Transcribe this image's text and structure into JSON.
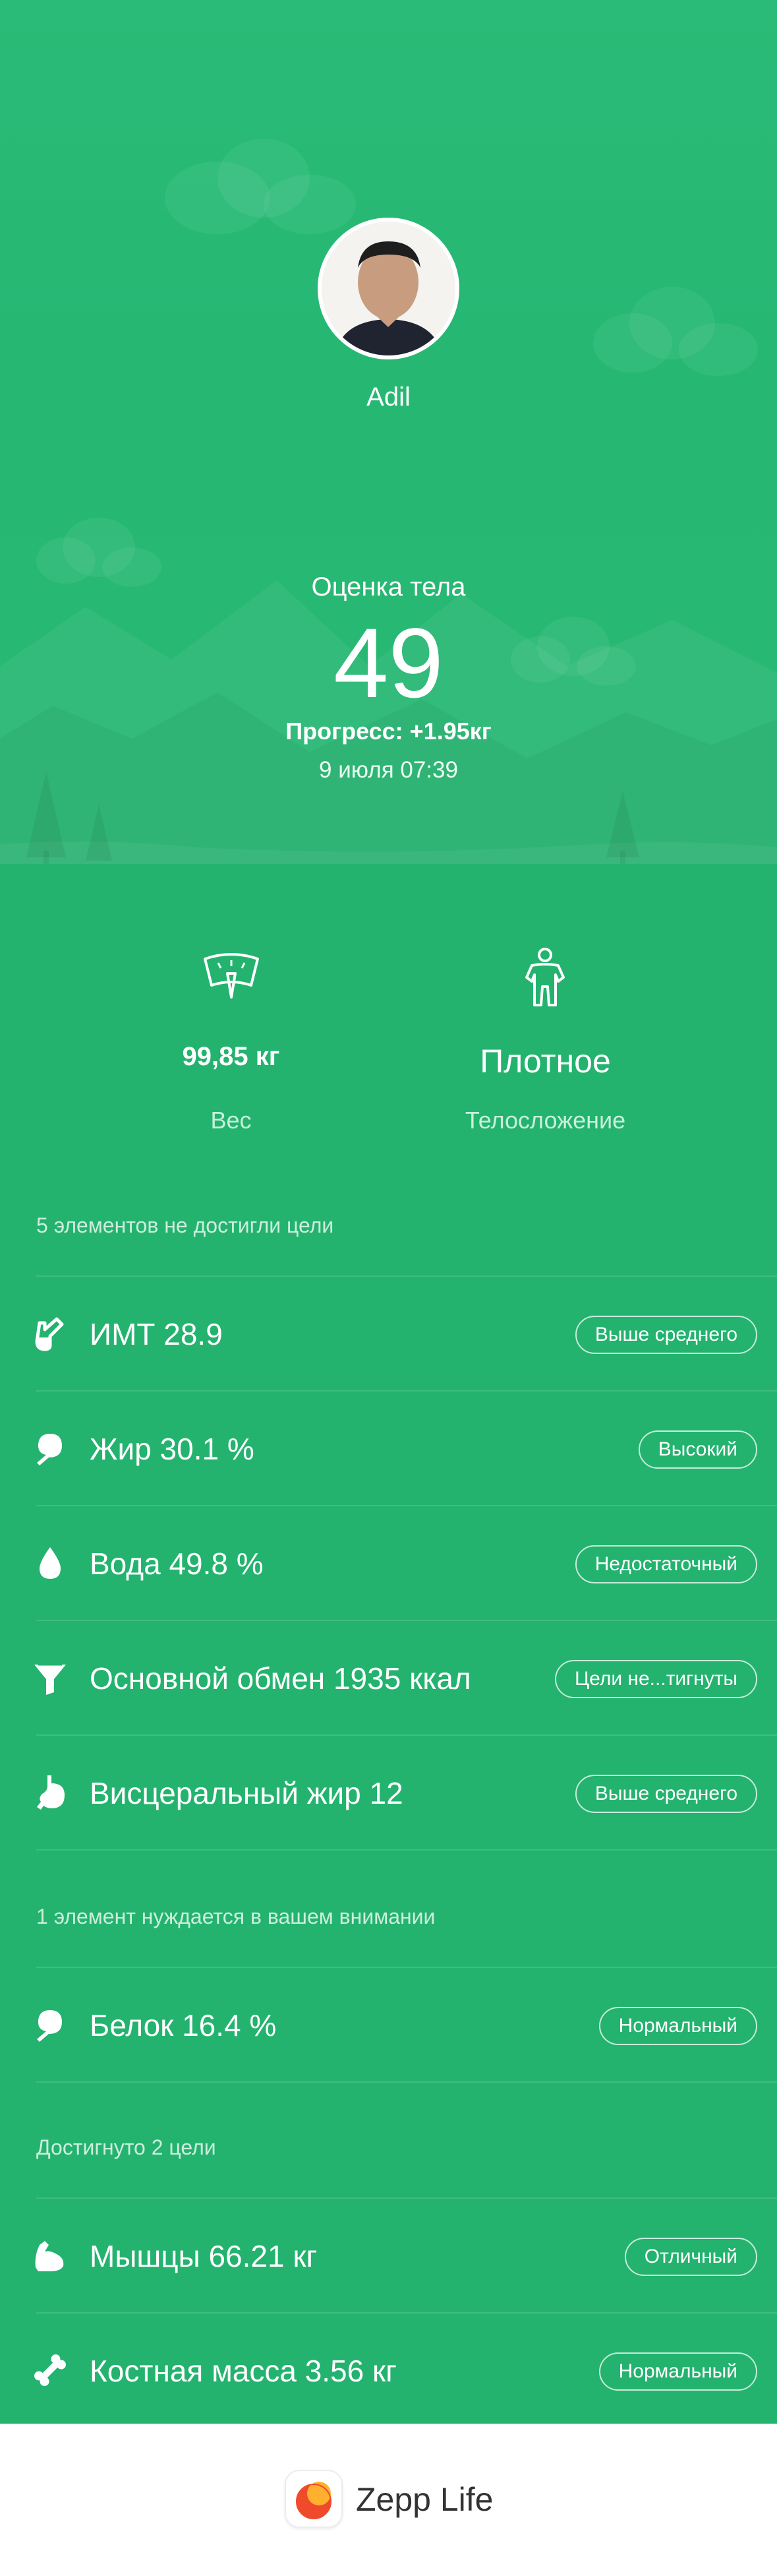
{
  "user": {
    "name": "Adil"
  },
  "score": {
    "label": "Оценка тела",
    "value": "49",
    "progress": "Прогресс: +1.95кг",
    "date": "9 июля 07:39"
  },
  "stats": {
    "weight": {
      "value": "99,85 кг",
      "label": "Вес",
      "icon": "scale-icon"
    },
    "body_type": {
      "value": "Плотное",
      "label": "Телосложение",
      "icon": "body-type-icon"
    }
  },
  "sections": {
    "not_reached": {
      "title": "5 элементов не достигли цели"
    },
    "attention": {
      "title": "1 элемент нуждается в вашем внимании"
    },
    "reached": {
      "title": "Достигнуто 2 цели"
    }
  },
  "metrics": [
    {
      "label": "ИМТ 28.9",
      "badge": "Выше среднего",
      "icon": "bmi-icon"
    },
    {
      "label": "Жир 30.1 %",
      "badge": "Высокий",
      "icon": "fat-icon"
    },
    {
      "label": "Вода 49.8 %",
      "badge": "Недостаточный",
      "icon": "water-drop-icon"
    },
    {
      "label": "Основной обмен 1935 ккал",
      "badge": "Цели не...тигнуты",
      "icon": "funnel-icon"
    },
    {
      "label": "Висцеральный жир 12",
      "badge": "Выше среднего",
      "icon": "stomach-icon"
    },
    {
      "label": "Белок 16.4 %",
      "badge": "Нормальный",
      "icon": "protein-icon"
    },
    {
      "label": "Мышцы 66.21 кг",
      "badge": "Отличный",
      "icon": "muscle-icon"
    },
    {
      "label": "Костная масса 3.56 кг",
      "badge": "Нормальный",
      "icon": "bone-icon"
    }
  ],
  "footer": {
    "app_name": "Zepp Life"
  },
  "colors": {
    "hero": "#29bb77",
    "content": "#23b36f",
    "footer": "#ffffff"
  }
}
